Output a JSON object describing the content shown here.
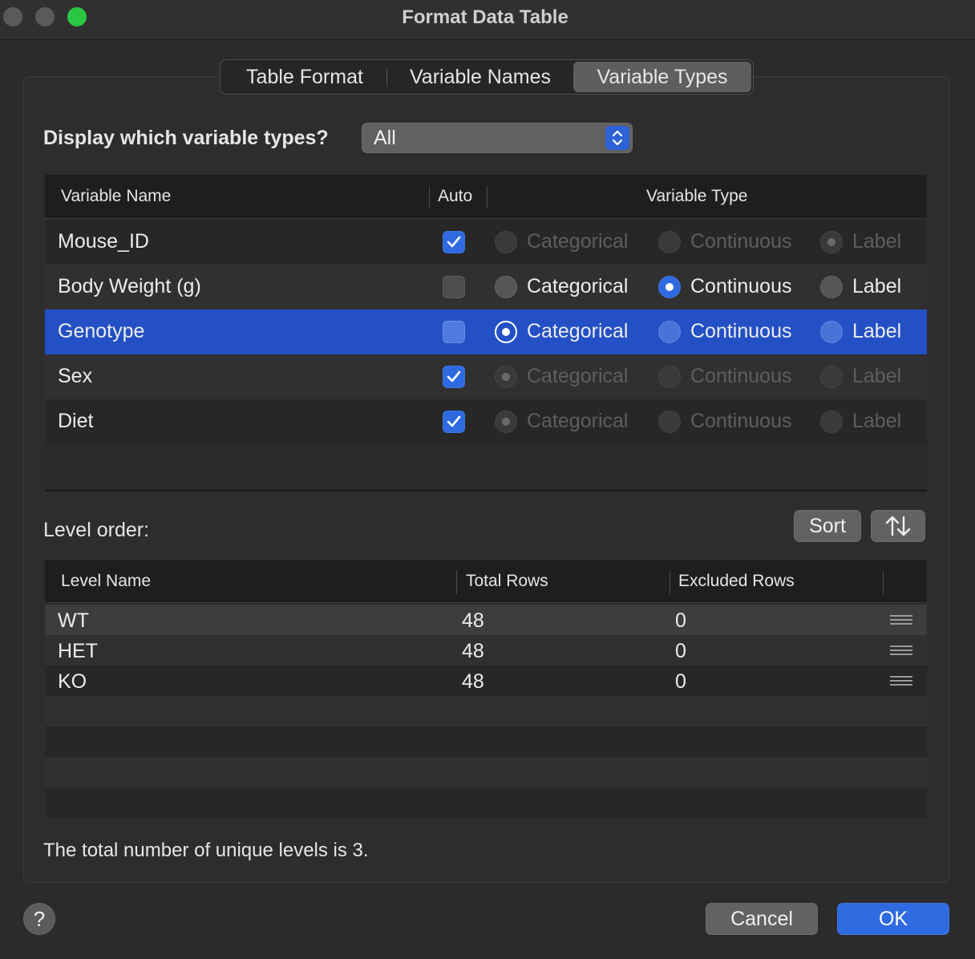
{
  "window": {
    "title": "Format Data Table"
  },
  "tabs": [
    {
      "label": "Table Format"
    },
    {
      "label": "Variable Names"
    },
    {
      "label": "Variable Types",
      "selected": true
    }
  ],
  "filter": {
    "label": "Display which variable types?",
    "value": "All"
  },
  "variables": {
    "headers": {
      "name": "Variable Name",
      "auto": "Auto",
      "type": "Variable Type"
    },
    "type_options": [
      "Categorical",
      "Continuous",
      "Label"
    ],
    "rows": [
      {
        "name": "Mouse_ID",
        "auto": true,
        "type": "Label",
        "selected": false
      },
      {
        "name": "Body Weight (g)",
        "auto": false,
        "type": "Continuous",
        "selected": false
      },
      {
        "name": "Genotype",
        "auto": false,
        "type": "Categorical",
        "selected": true
      },
      {
        "name": "Sex",
        "auto": true,
        "type": "Categorical",
        "selected": false
      },
      {
        "name": "Diet",
        "auto": true,
        "type": "Categorical",
        "selected": false
      }
    ]
  },
  "levels": {
    "label": "Level order:",
    "sort_label": "Sort",
    "headers": {
      "name": "Level Name",
      "total": "Total Rows",
      "excluded": "Excluded Rows"
    },
    "rows": [
      {
        "name": "WT",
        "total": "48",
        "excluded": "0"
      },
      {
        "name": "HET",
        "total": "48",
        "excluded": "0"
      },
      {
        "name": "KO",
        "total": "48",
        "excluded": "0"
      }
    ],
    "summary": "The total number of unique levels is 3."
  },
  "footer": {
    "help": "?",
    "cancel": "Cancel",
    "ok": "OK"
  },
  "colors": {
    "accent": "#2f6ae0",
    "selection": "#2350c4",
    "traffic_green": "#2ac742"
  }
}
